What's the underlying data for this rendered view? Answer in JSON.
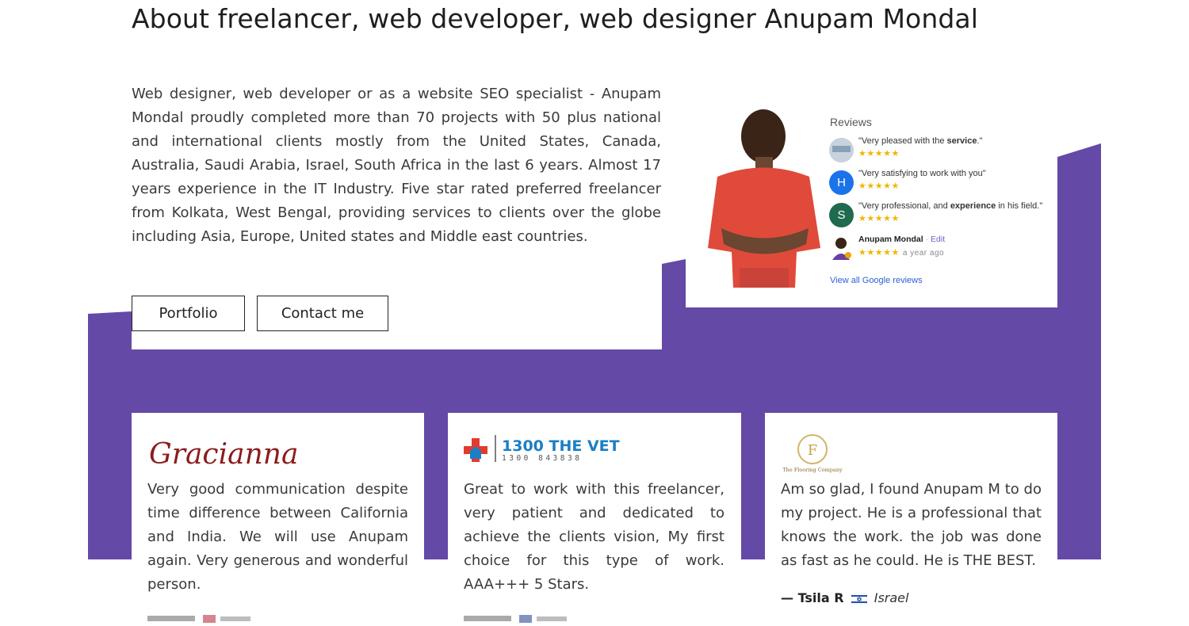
{
  "page": {
    "heading": "About freelancer, web developer, web designer Anupam Mondal",
    "intro": "Web designer, web developer or as a website SEO specialist - Anupam Mondal proudly completed more than 70 projects with 50 plus national and international clients mostly from the United States, Canada, Australia, Saudi Arabia, Israel, South Africa in the last 6 years. Almost 17 years experience in the IT Industry. Five star rated preferred freelancer from Kolkata, West Bengal, providing services to clients over the globe including Asia, Europe, United states and Middle east countries.",
    "buttons": {
      "portfolio": "Portfolio",
      "contact": "Contact me"
    }
  },
  "reviews_widget": {
    "title": "Reviews",
    "items": [
      {
        "avatar": "logo",
        "text_before": "\"Very pleased with the ",
        "bold": "service",
        "text_after": ".\"",
        "stars": "★★★★★"
      },
      {
        "avatar": "H",
        "text_before": "\"Very satisfying to work with you\"",
        "bold": "",
        "text_after": "",
        "stars": "★★★★★"
      },
      {
        "avatar": "S",
        "text_before": "\"Very professional, and ",
        "bold": "experience",
        "text_after": " in his field.\"",
        "stars": "★★★★★"
      }
    ],
    "owner_reply": {
      "name": "Anupam Mondal",
      "sep": "·",
      "edit": "Edit",
      "stars": "★★★★★",
      "time": "a year ago"
    },
    "link": "View all Google reviews"
  },
  "testimonials": [
    {
      "logo_text": "Gracianna",
      "text": "Very good communication despite time difference between California and India. We will use Anupam again. Very generous and wonderful person."
    },
    {
      "logo_text": "1300 THE VET",
      "logo_subtext": "1300 843838",
      "text": "Great to work with this freelancer, very patient and dedicated to achieve the clients vision, My first choice for this type of work. AAA+++ 5 Stars."
    },
    {
      "logo_text": "The Flooring Company",
      "text": "Am so glad, I found Anupam M to do my project. He is a professional that knows the work. the job was done as fast as he could. He is THE BEST.",
      "author_dash": "— Tsila R",
      "author_country": "Israel"
    }
  ],
  "colors": {
    "purple": "#6449a6",
    "star": "#f4b400",
    "link": "#2b5fd9"
  }
}
